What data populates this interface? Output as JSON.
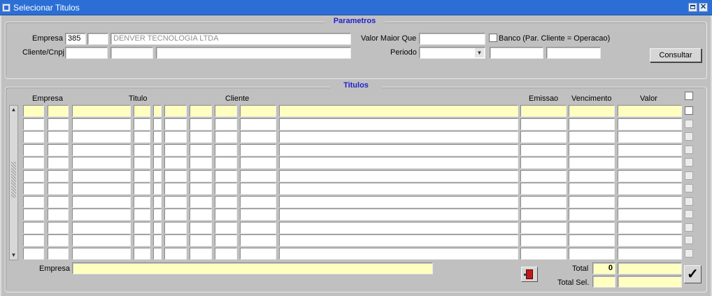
{
  "window": {
    "title": "Selecionar Titulos"
  },
  "parametros": {
    "title": "Parametros",
    "empresa_label": "Empresa",
    "empresa_code": "385",
    "empresa_extra": "",
    "empresa_name": "DENVER TECNOLOGIA LTDA",
    "cliente_label": "Cliente/Cnpj",
    "cliente_1": "",
    "cliente_2": "",
    "cliente_3": "",
    "valor_maior_label": "Valor Maior Que",
    "valor_maior_value": "",
    "banco_label": "Banco (Par. Cliente = Operacao)",
    "periodo_label": "Periodo",
    "periodo_select": "",
    "periodo_from": "",
    "periodo_to": "",
    "consultar_label": "Consultar"
  },
  "titulos": {
    "title": "Titulos",
    "headers": {
      "empresa": "Empresa",
      "titulo": "Titulo",
      "cliente": "Cliente",
      "emissao": "Emissao",
      "vencimento": "Vencimento",
      "valor": "Valor"
    },
    "row_count": 12
  },
  "footer": {
    "empresa_label": "Empresa",
    "empresa_value": "",
    "total_label": "Total",
    "total_count": "0",
    "total_value": "",
    "total_sel_label": "Total Sel.",
    "total_sel_count": "",
    "total_sel_value": ""
  },
  "icons": {
    "app": "form-icon",
    "maximize": "maximize-icon",
    "close": "close-icon",
    "exit": "exit-door-icon",
    "confirm": "checkmark-icon",
    "dropdown": "chevron-down-icon"
  }
}
